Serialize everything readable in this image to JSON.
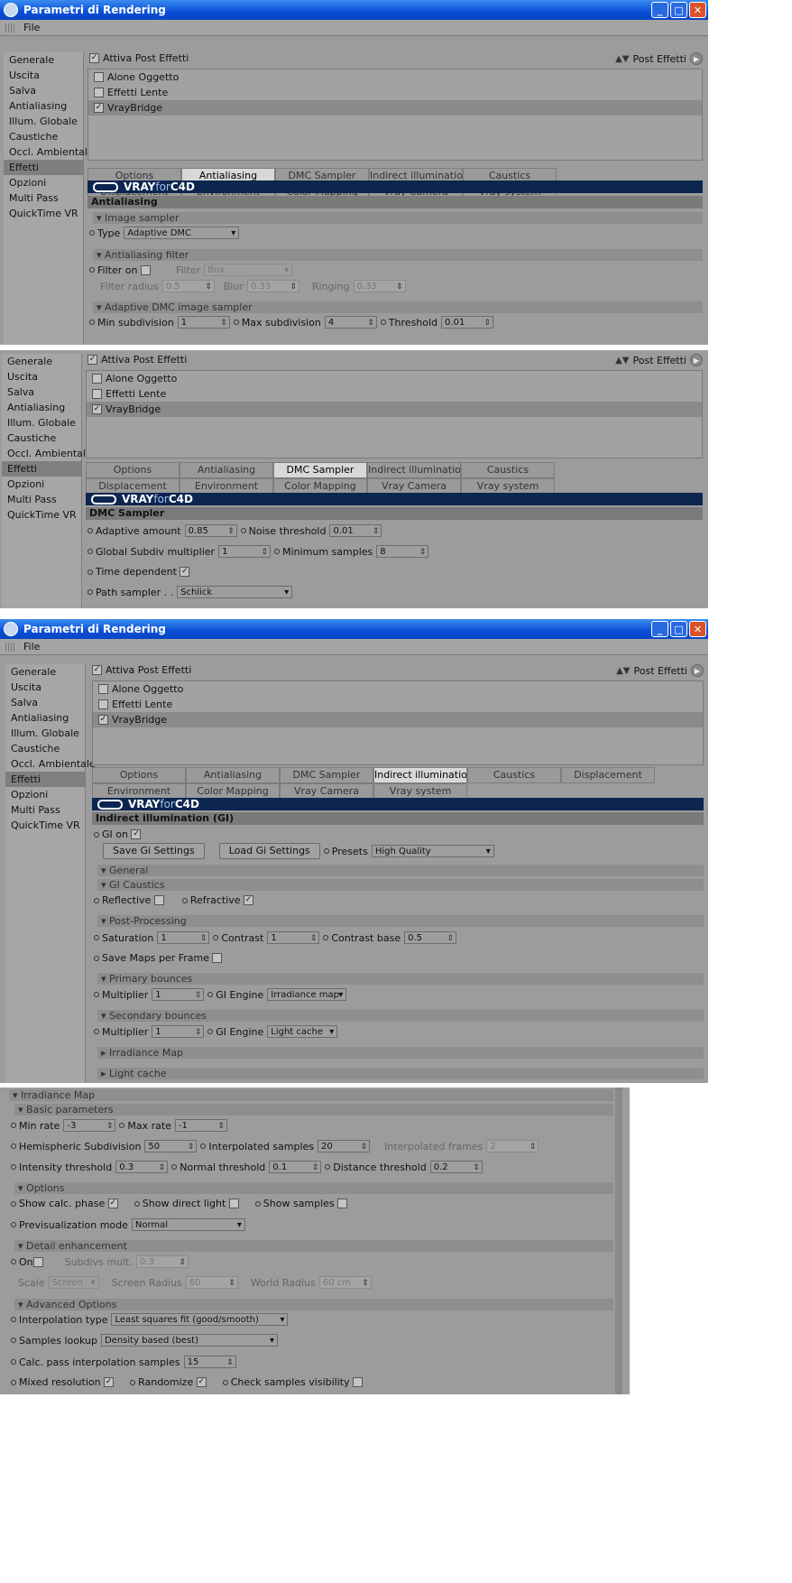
{
  "window": {
    "title": "Parametri di Rendering",
    "menu_file": "File"
  },
  "sidebar": [
    "Generale",
    "Uscita",
    "Salva",
    "Antialiasing",
    "Illum. Globale",
    "Caustiche",
    "Occl. Ambientale",
    "Effetti",
    "Opzioni",
    "Multi Pass",
    "QuickTime VR"
  ],
  "post": {
    "enable_label": "Attiva Post Effetti",
    "menu_label": "Post Effetti",
    "effects": [
      "Alone Oggetto",
      "Effetti Lente",
      "VrayBridge"
    ]
  },
  "tabs": {
    "row1": [
      "Options",
      "Antialiasing",
      "DMC Sampler",
      "Indirect illumination (GI)",
      "Caustics"
    ],
    "row2": [
      "Displacement",
      "Environment",
      "Color Mapping",
      "Vray Camera",
      "Vray system"
    ],
    "gi_row1": [
      "Options",
      "Antialiasing",
      "DMC Sampler",
      "Indirect illumination (GI)",
      "Caustics",
      "Displacement"
    ],
    "gi_row2": [
      "Environment",
      "Color Mapping",
      "Vray Camera",
      "Vray system"
    ]
  },
  "brand": {
    "vray": "VRAY",
    "for": "for",
    "c4d": "C4D"
  },
  "aa": {
    "title": "Antialiasing",
    "image_sampler": "Image sampler",
    "type_label": "Type",
    "type_value": "Adaptive DMC",
    "filter_group": "Antialiasing filter",
    "filter_on": "Filter on",
    "filter_label": "Filter",
    "filter_value": "Box",
    "radius_label": "Filter radius",
    "radius_value": "0.5",
    "blur_label": "Blur",
    "blur_value": "0.33",
    "ringing_label": "Ringing",
    "ringing_value": "0.33",
    "dmc_group": "Adaptive DMC image sampler",
    "min_label": "Min subdivision",
    "min_value": "1",
    "max_label": "Max subdivision",
    "max_value": "4",
    "thr_label": "Threshold",
    "thr_value": "0.01"
  },
  "dmc": {
    "title": "DMC Sampler",
    "adaptive_label": "Adaptive amount",
    "adaptive_value": "0.85",
    "noise_label": "Noise threshold",
    "noise_value": "0.01",
    "gsub_label": "Global Subdiv multiplier",
    "gsub_value": "1",
    "minsamp_label": "Minimum samples",
    "minsamp_value": "8",
    "time_label": "Time dependent",
    "path_label": "Path sampler . .",
    "path_value": "Schlick"
  },
  "gi": {
    "title": "Indirect illumination (GI)",
    "gi_on": "GI on",
    "save_btn": "Save Gi Settings",
    "load_btn": "Load Gi Settings",
    "presets_label": "Presets",
    "presets_value": "High Quality",
    "general": "General",
    "caustics": "GI Caustics",
    "reflective": "Reflective",
    "refractive": "Refractive",
    "post": "Post-Processing",
    "sat_label": "Saturation",
    "sat_value": "1",
    "con_label": "Contrast",
    "con_value": "1",
    "cb_label": "Contrast base",
    "cb_value": "0.5",
    "save_maps": "Save Maps per Frame",
    "primary": "Primary bounces",
    "mult_label": "Multiplier",
    "mult_value": "1",
    "engine_label": "GI Engine",
    "engine1": "Irradiance map",
    "secondary": "Secondary bounces",
    "engine2": "Light cache",
    "irr": "Irradiance Map",
    "lc": "Light cache"
  },
  "irr": {
    "title": "Irradiance Map",
    "basic": "Basic parameters",
    "minrate_label": "Min rate",
    "minrate_value": "-3",
    "maxrate_label": "Max rate",
    "maxrate_value": "-1",
    "hemi_label": "Hemispheric Subdivision",
    "hemi_value": "50",
    "interp_label": "Interpolated samples",
    "interp_value": "20",
    "frames_label": "Interpolated frames",
    "frames_value": "2",
    "int_label": "Intensity threshold",
    "int_value": "0.3",
    "norm_label": "Normal threshold",
    "norm_value": "0.1",
    "dist_label": "Distance threshold",
    "dist_value": "0.2",
    "options": "Options",
    "show_calc": "Show calc. phase",
    "show_direct": "Show direct light",
    "show_samples": "Show samples",
    "previs_label": "Previsualization mode",
    "previs_value": "Normal",
    "detail": "Detail enhancement",
    "on_label": "On",
    "subdivs_label": "Subdivs mult.",
    "subdivs_value": "0.3",
    "scale_label": "Scale",
    "scale_value": "Screen",
    "sradius_label": "Screen Radius",
    "sradius_value": "60",
    "wradius_label": "World Radius",
    "wradius_value": "60 cm",
    "adv": "Advanced Options",
    "itype_label": "Interpolation type",
    "itype_value": "Least squares fit (good/smooth)",
    "lookup_label": "Samples lookup",
    "lookup_value": "Density based (best)",
    "calc_label": "Calc. pass interpolation samples",
    "calc_value": "15",
    "mixed": "Mixed resolution",
    "random": "Randomize",
    "check": "Check samples visibility"
  }
}
